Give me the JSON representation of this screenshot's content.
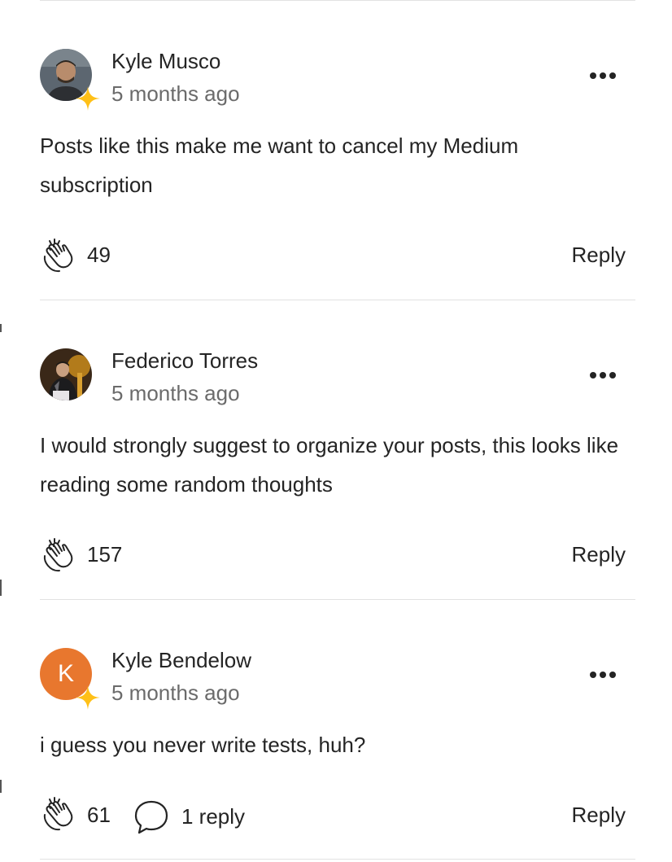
{
  "comments": [
    {
      "author": "Kyle Musco",
      "timestamp": "5 months ago",
      "body": "Posts like this make me want to cancel my Medium subscription",
      "claps": "49",
      "reply_label": "Reply",
      "member": true,
      "avatar": "photo"
    },
    {
      "author": "Federico Torres",
      "timestamp": "5 months ago",
      "body": "I would strongly suggest to organize your posts, this looks like reading some random thoughts",
      "claps": "157",
      "reply_label": "Reply",
      "member": false,
      "avatar": "photo"
    },
    {
      "author": "Kyle Bendelow",
      "timestamp": "5 months ago",
      "body": "i guess you never write tests, huh?",
      "claps": "61",
      "replies": "1 reply",
      "reply_label": "Reply",
      "member": true,
      "avatar": "letter",
      "avatar_letter": "K",
      "avatar_color": "#e8772e"
    }
  ],
  "icons": {
    "more": "more-horizontal-icon",
    "clap": "clap-icon",
    "reply": "speech-bubble-icon",
    "member": "member-star-icon"
  },
  "colors": {
    "text": "#242424",
    "muted": "#6b6b6b",
    "divider": "#e2e2e2",
    "member_star": "#ffc017",
    "letter_avatar": "#e8772e"
  }
}
